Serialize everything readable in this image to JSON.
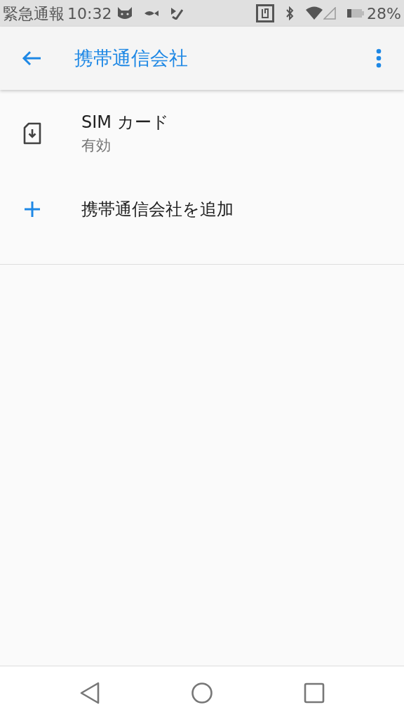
{
  "status_bar": {
    "carrier_text": "緊急通報",
    "time": "10:32",
    "battery_percent": "28%"
  },
  "app_bar": {
    "title": "携帯通信会社"
  },
  "items": [
    {
      "kind": "sim",
      "title": "SIM カード",
      "subtitle": "有効"
    },
    {
      "kind": "add",
      "title": "携帯通信会社を追加"
    }
  ]
}
